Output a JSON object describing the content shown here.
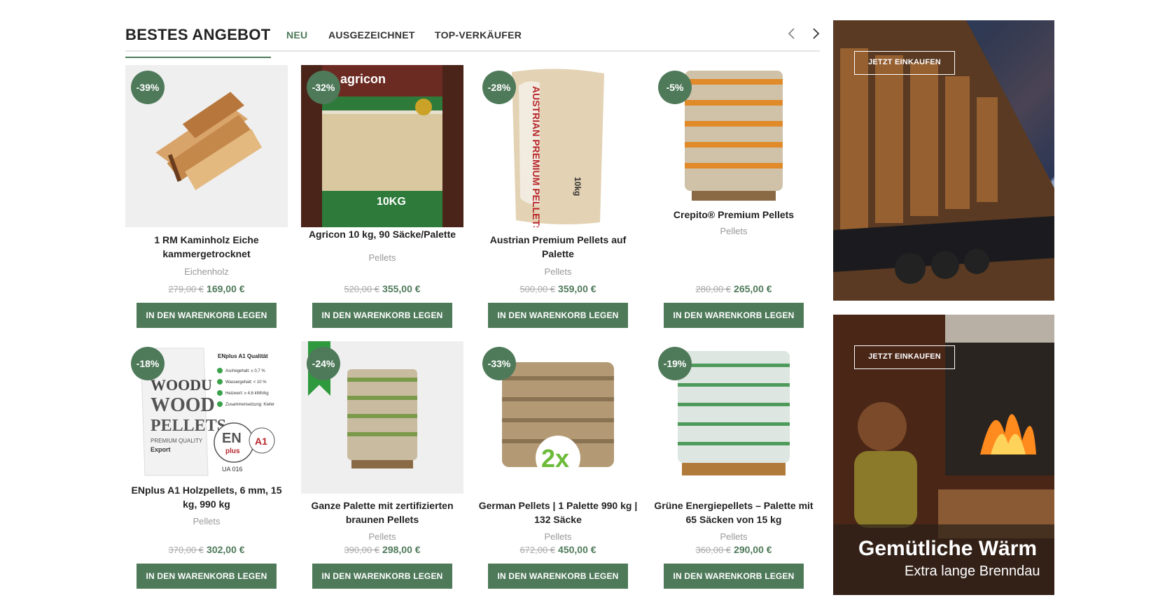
{
  "header": {
    "title": "BESTES ANGEBOT",
    "tabs": [
      {
        "label": "NEU",
        "active": true
      },
      {
        "label": "AUSGEZEICHNET",
        "active": false
      },
      {
        "label": "TOP-VERKÄUFER",
        "active": false
      }
    ],
    "prev_icon": "chevron-left-icon",
    "next_icon": "chevron-right-icon"
  },
  "products": [
    {
      "badge": "-39%",
      "title": "1 RM Kaminholz Eiche kammergetrocknet",
      "category": "Eichenholz",
      "old_price": "279,00 €",
      "price": "169,00 €",
      "button": "IN DEN WARENKORB LEGEN",
      "image": "firewood-logs"
    },
    {
      "badge": "-32%",
      "title": "Agricon 10 kg, 90 Säcke/Palette",
      "category": "Pellets",
      "old_price": "520,00 €",
      "price": "355,00 €",
      "button": "IN DEN WARENKORB LEGEN",
      "image": "agricon-pellet-bag"
    },
    {
      "badge": "-28%",
      "title": "Austrian Premium Pellets auf Palette",
      "category": "Pellets",
      "old_price": "500,00 €",
      "price": "359,00 €",
      "button": "IN DEN WARENKORB LEGEN",
      "image": "austrian-pellet-bag"
    },
    {
      "badge": "-5%",
      "title": "Crepito® Premium Pellets",
      "category": "Pellets",
      "old_price": "280,00 €",
      "price": "265,00 €",
      "button": "IN DEN WARENKORB LEGEN",
      "image": "pellet-pallet"
    },
    {
      "badge": "-18%",
      "title": "ENplus A1 Holzpellets, 6 mm, 15 kg, 990 kg",
      "category": "Pellets",
      "old_price": "370,00 €",
      "price": "302,00 €",
      "button": "IN DEN WARENKORB LEGEN",
      "image": "woodu-pellet-bag"
    },
    {
      "badge": "-24%",
      "title": "Ganze Palette mit zertifizierten braunen Pellets",
      "category": "Pellets",
      "old_price": "390,00 €",
      "price": "298,00 €",
      "button": "IN DEN WARENKORB LEGEN",
      "image": "brown-pellet-pallet"
    },
    {
      "badge": "-33%",
      "title": "German Pellets | 1 Palette 990 kg | 132 Säcke",
      "category": "Pellets",
      "old_price": "672,00 €",
      "price": "450,00 €",
      "button": "IN DEN WARENKORB LEGEN",
      "image": "german-pellet-pallet"
    },
    {
      "badge": "-19%",
      "title": "Grüne Energiepellets – Palette mit 65 Säcken von 15 kg",
      "category": "Pellets",
      "old_price": "360,00 €",
      "price": "290,00 €",
      "button": "IN DEN WARENKORB LEGEN",
      "image": "green-energy-pallet"
    }
  ],
  "banners": [
    {
      "button": "JETZT EINKAUFEN",
      "image": "truck-firewood"
    },
    {
      "button": "JETZT EINKAUFEN",
      "title": "Gemütliche Wärm",
      "subtitle": "Extra lange Brenndau",
      "image": "fireplace-woman"
    }
  ],
  "image_texts": {
    "agricon_brand": "agricon",
    "agricon_weight": "10KG",
    "austrian_label": "AUSTRIAN PREMIUM PELLETS",
    "austrian_weight": "10kg",
    "woodu_brand": "WOODU",
    "woodu_word1": "WOOD",
    "woodu_word2": "PELLETS",
    "woodu_sub": "PREMIUM QUALITY",
    "woodu_export": "Export",
    "enplus_heading": "ENplus A1 Qualität",
    "enplus_specs": [
      "Aschegehalt: ≤ 0,7 %",
      "Wassergehalt: < 10 %",
      "Heizwert: ≥ 4,6 kWh/kg",
      "Zusammensetzung: Kiefer"
    ],
    "enplus_logo": "EN",
    "enplus_plus": "plus",
    "enplus_grade": "A1",
    "enplus_code": "UA 016",
    "german_2x": "2x"
  },
  "colors": {
    "accent": "#4f7a5a",
    "badge": "#4f7a5a",
    "old_price": "#aaaaaa",
    "ribbon": "#2e9a3d"
  }
}
